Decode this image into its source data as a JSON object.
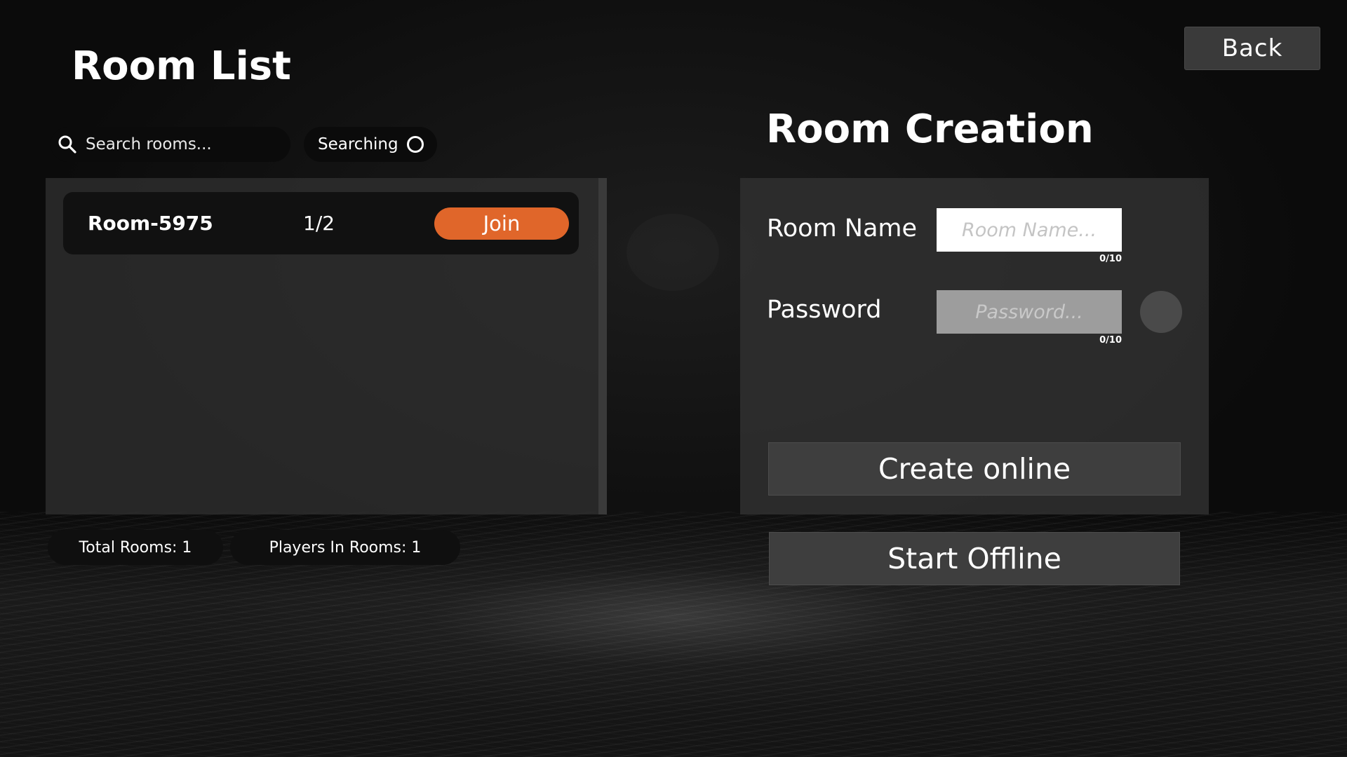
{
  "header": {
    "room_list_title": "Room List",
    "room_creation_title": "Room Creation",
    "back_label": "Back"
  },
  "search": {
    "placeholder": "Search rooms...",
    "status_label": "Searching",
    "status_icon": "spinner-icon"
  },
  "rooms": [
    {
      "name": "Room-5975",
      "players": "1/2",
      "join_label": "Join"
    }
  ],
  "stats": {
    "total_rooms": "Total Rooms: 1",
    "players_in_rooms": "Players In Rooms: 1"
  },
  "creation": {
    "room_name_label": "Room Name",
    "room_name_placeholder": "Room Name...",
    "room_name_counter": "0/10",
    "password_label": "Password",
    "password_placeholder": "Password...",
    "password_counter": "0/10",
    "create_online_label": "Create online",
    "start_offline_label": "Start Offline"
  },
  "colors": {
    "accent": "#e0662a",
    "panel": "#303030",
    "button": "#3e3e3e"
  }
}
